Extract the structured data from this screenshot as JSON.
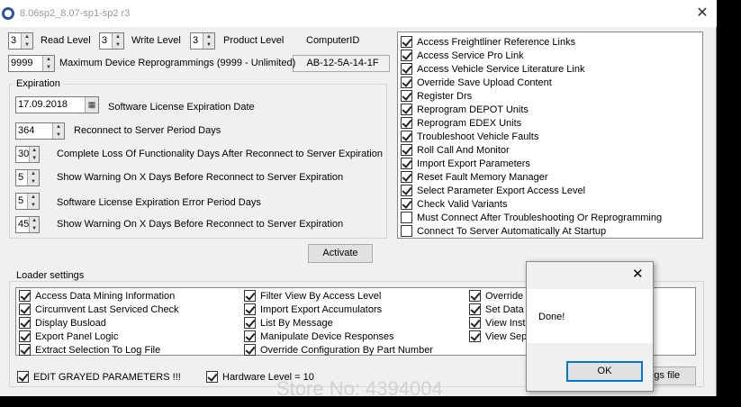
{
  "window": {
    "title": "8.06sp2_8.07-sp1-sp2 r3"
  },
  "top": {
    "read_level_value": "3",
    "read_level_label": "Read Level",
    "write_level_value": "3",
    "write_level_label": "Write Level",
    "product_level_value": "3",
    "product_level_label": "Product Level",
    "computer_id_label": "ComputerID",
    "computer_id_value": "AB-12-5A-14-1F",
    "max_reprog_value": "9999",
    "max_reprog_label": "Maximum Device Reprogrammings (9999 - Unlimited)"
  },
  "expiration": {
    "title": "Expiration",
    "date_value": "17.09.2018",
    "date_label": "Software License Expiration Date",
    "reconnect_value": "364",
    "reconnect_label": "Reconnect to Server Period Days",
    "loss_value": "30",
    "loss_label": "Complete Loss Of Functionality Days After Reconnect to Server Expiration",
    "warn1_value": "5",
    "warn1_label": "Show Warning On X Days Before Reconnect to Server Expiration",
    "error_value": "5",
    "error_label": "Software License Expiration Error Period Days",
    "warn2_value": "45",
    "warn2_label": "Show Warning On X Days Before Reconnect to Server Expiration"
  },
  "activate_label": "Activate",
  "permissions": [
    {
      "label": "Access Freightliner Reference Links",
      "checked": true
    },
    {
      "label": "Access Service Pro Link",
      "checked": true
    },
    {
      "label": "Access Vehicle Service Literature Link",
      "checked": true
    },
    {
      "label": "Override Save Upload Content",
      "checked": true
    },
    {
      "label": "Register Drs",
      "checked": true
    },
    {
      "label": "Reprogram DEPOT Units",
      "checked": true
    },
    {
      "label": "Reprogram EDEX Units",
      "checked": true
    },
    {
      "label": "Troubleshoot Vehicle Faults",
      "checked": true
    },
    {
      "label": "Roll Call And Monitor",
      "checked": true
    },
    {
      "label": "Import Export Parameters",
      "checked": true
    },
    {
      "label": "Reset Fault Memory Manager",
      "checked": true
    },
    {
      "label": "Select Parameter Export Access Level",
      "checked": true
    },
    {
      "label": "Check Valid Variants",
      "checked": true
    },
    {
      "label": "Must Connect After Troubleshooting Or Reprogramming",
      "checked": false
    },
    {
      "label": "Connect To Server Automatically At Startup",
      "checked": false
    }
  ],
  "loader": {
    "title": "Loader settings",
    "col1": [
      {
        "label": "Access Data Mining Information",
        "checked": true
      },
      {
        "label": "Circumvent Last Serviced Check",
        "checked": true
      },
      {
        "label": "Display Busload",
        "checked": true
      },
      {
        "label": "Export Panel Logic",
        "checked": true
      },
      {
        "label": "Extract Selection To Log File",
        "checked": true
      }
    ],
    "col2": [
      {
        "label": "Filter View By Access Level",
        "checked": true
      },
      {
        "label": "Import Export Accumulators",
        "checked": true
      },
      {
        "label": "List By Message",
        "checked": true
      },
      {
        "label": "Manipulate Device Responses",
        "checked": true
      },
      {
        "label": "Override Configuration By Part Number",
        "checked": true
      }
    ],
    "col3": [
      {
        "label": "Override I",
        "checked": true
      },
      {
        "label": "Set Data",
        "checked": true
      },
      {
        "label": "View Instr",
        "checked": true
      },
      {
        "label": "View Sep",
        "checked": true
      }
    ],
    "edit_grayed_label": "EDIT GRAYED PARAMETERS !!!",
    "edit_grayed_checked": true,
    "hardware_level_label": "Hardware Level = 10",
    "hardware_level_checked": true,
    "settings_file_button": "ings file"
  },
  "dialog": {
    "message": "Done!",
    "ok_label": "OK",
    "close_glyph": "✕"
  },
  "watermark": "Store No: 4394004"
}
